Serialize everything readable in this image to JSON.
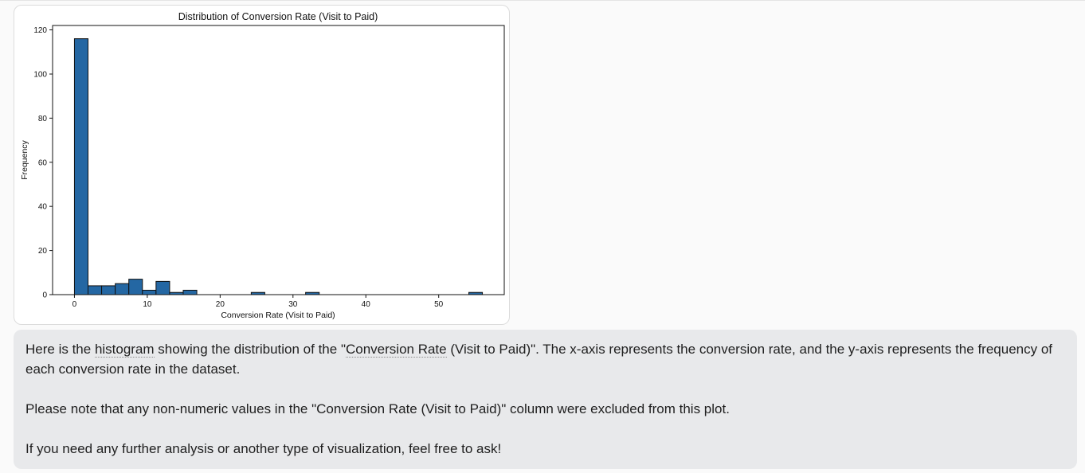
{
  "chart_data": {
    "type": "bar",
    "title": "Distribution of Conversion Rate (Visit to Paid)",
    "xlabel": "Conversion Rate (Visit to Paid)",
    "ylabel": "Frequency",
    "xlim": [
      -3,
      59
    ],
    "ylim": [
      0,
      122
    ],
    "xticks": [
      0,
      10,
      20,
      30,
      40,
      50
    ],
    "yticks": [
      0,
      20,
      40,
      60,
      80,
      100,
      120
    ],
    "bin_edges": [
      0,
      1.867,
      3.733,
      5.6,
      7.467,
      9.333,
      11.2,
      13.067,
      14.933,
      16.8,
      18.667,
      20.533,
      22.4,
      24.267,
      26.133,
      28.0,
      29.867,
      31.733,
      33.6,
      35.467,
      37.333,
      39.2,
      41.067,
      42.933,
      44.8,
      46.667,
      48.533,
      50.4,
      52.267,
      54.133,
      56.0
    ],
    "counts": [
      116,
      4,
      4,
      5,
      7,
      2,
      6,
      1,
      2,
      0,
      0,
      0,
      0,
      1,
      0,
      0,
      0,
      1,
      0,
      0,
      0,
      0,
      0,
      0,
      0,
      0,
      0,
      0,
      0,
      1
    ],
    "colors": {
      "bar_fill": "#2467a3",
      "bar_edge": "#111111"
    },
    "grid": false,
    "legend": "none"
  },
  "message": {
    "p1_before": "Here is the ",
    "p1_link1": "histogram",
    "p1_mid": " showing the distribution of the \"",
    "p1_link2": "Conversion Rate",
    "p1_after": " (Visit to Paid)\". The x-axis represents the conversion rate, and the y-axis represents the frequency of each conversion rate in the dataset.",
    "p2": "Please note that any non-numeric values in the \"Conversion Rate (Visit to Paid)\" column were excluded from this plot.",
    "p3": "If you need any further analysis or another type of visualization, feel free to ask!"
  }
}
